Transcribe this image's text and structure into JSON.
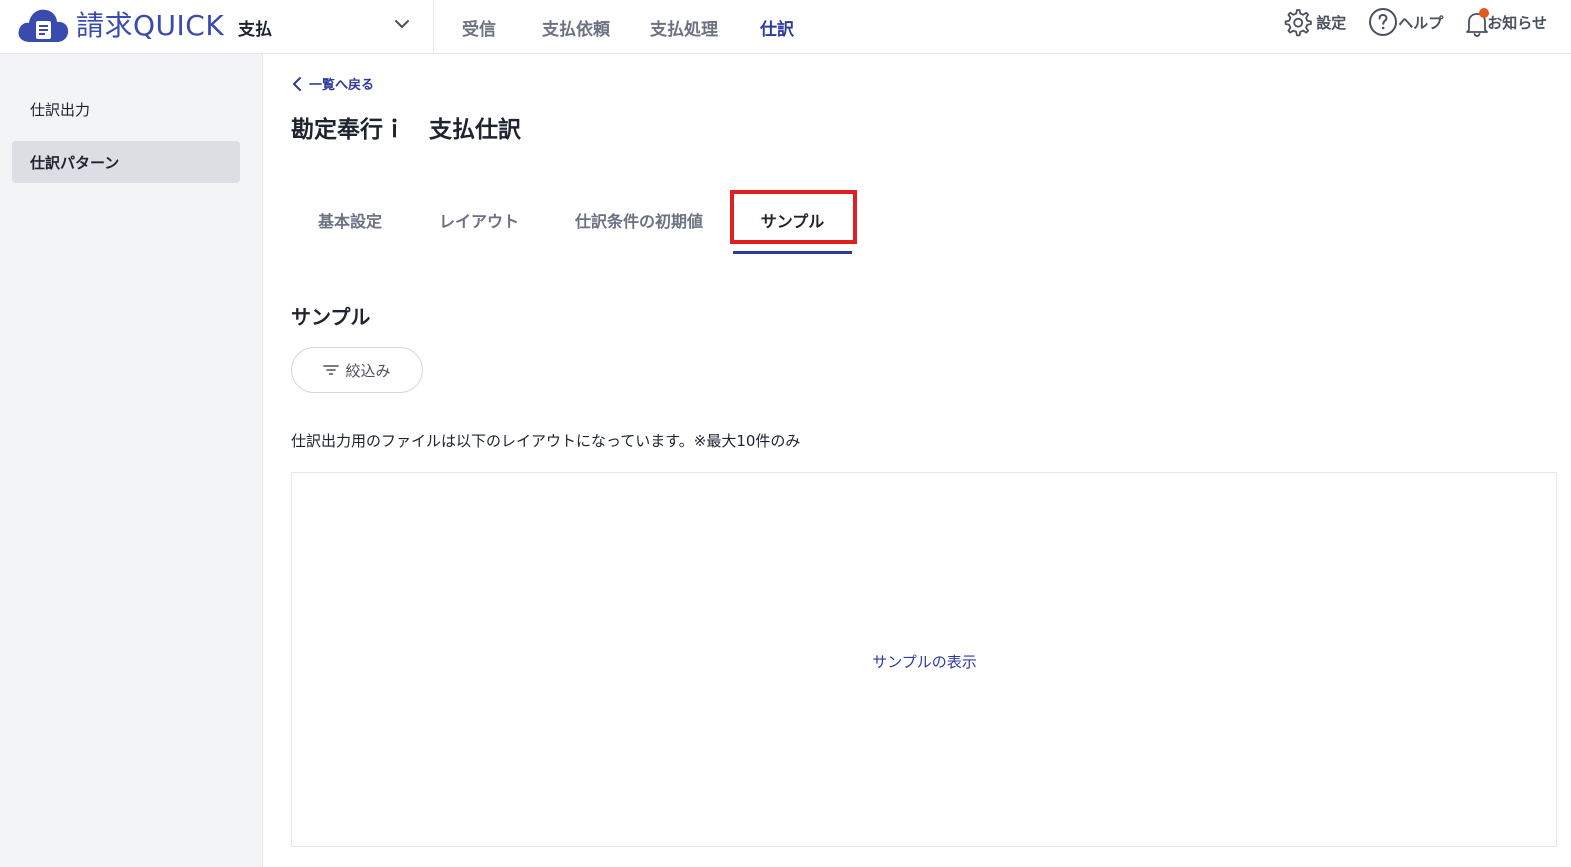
{
  "colors": {
    "brand": "#3a4bb0",
    "accent": "#2e3a9e",
    "highlight_border": "#e02020",
    "notification_dot": "#e5581e",
    "sidebar_bg": "#f3f4f6"
  },
  "header": {
    "logo_text": "請求QUICK",
    "module_selector": {
      "value": "支払",
      "icon": "chevron-down-icon"
    },
    "nav": [
      {
        "label": "受信",
        "active": false
      },
      {
        "label": "支払依頼",
        "active": false
      },
      {
        "label": "支払処理",
        "active": false
      },
      {
        "label": "仕訳",
        "active": true
      }
    ],
    "tools": {
      "settings": {
        "label": "設定",
        "icon": "gear-icon"
      },
      "help": {
        "label": "ヘルプ",
        "icon": "help-circle-icon"
      },
      "notifications": {
        "label": "お知らせ",
        "icon": "bell-icon",
        "has_unread": true
      }
    }
  },
  "sidebar": {
    "items": [
      {
        "label": "仕訳出力",
        "active": false
      },
      {
        "label": "仕訳パターン",
        "active": true
      }
    ]
  },
  "main": {
    "back_link": {
      "label": "一覧へ戻る",
      "icon": "chevron-left-icon"
    },
    "page_title": "勘定奉行ｉ　支払仕訳",
    "tabs": [
      {
        "label": "基本設定",
        "active": false
      },
      {
        "label": "レイアウト",
        "active": false
      },
      {
        "label": "仕訳条件の初期値",
        "active": false
      },
      {
        "label": "サンプル",
        "active": true,
        "highlighted": true
      }
    ],
    "section_title": "サンプル",
    "filter_button": {
      "label": "絞込み",
      "icon": "filter-icon"
    },
    "description": "仕訳出力用のファイルは以下のレイアウトになっています。※最大10件のみ",
    "sample_display_link": "サンプルの表示"
  }
}
